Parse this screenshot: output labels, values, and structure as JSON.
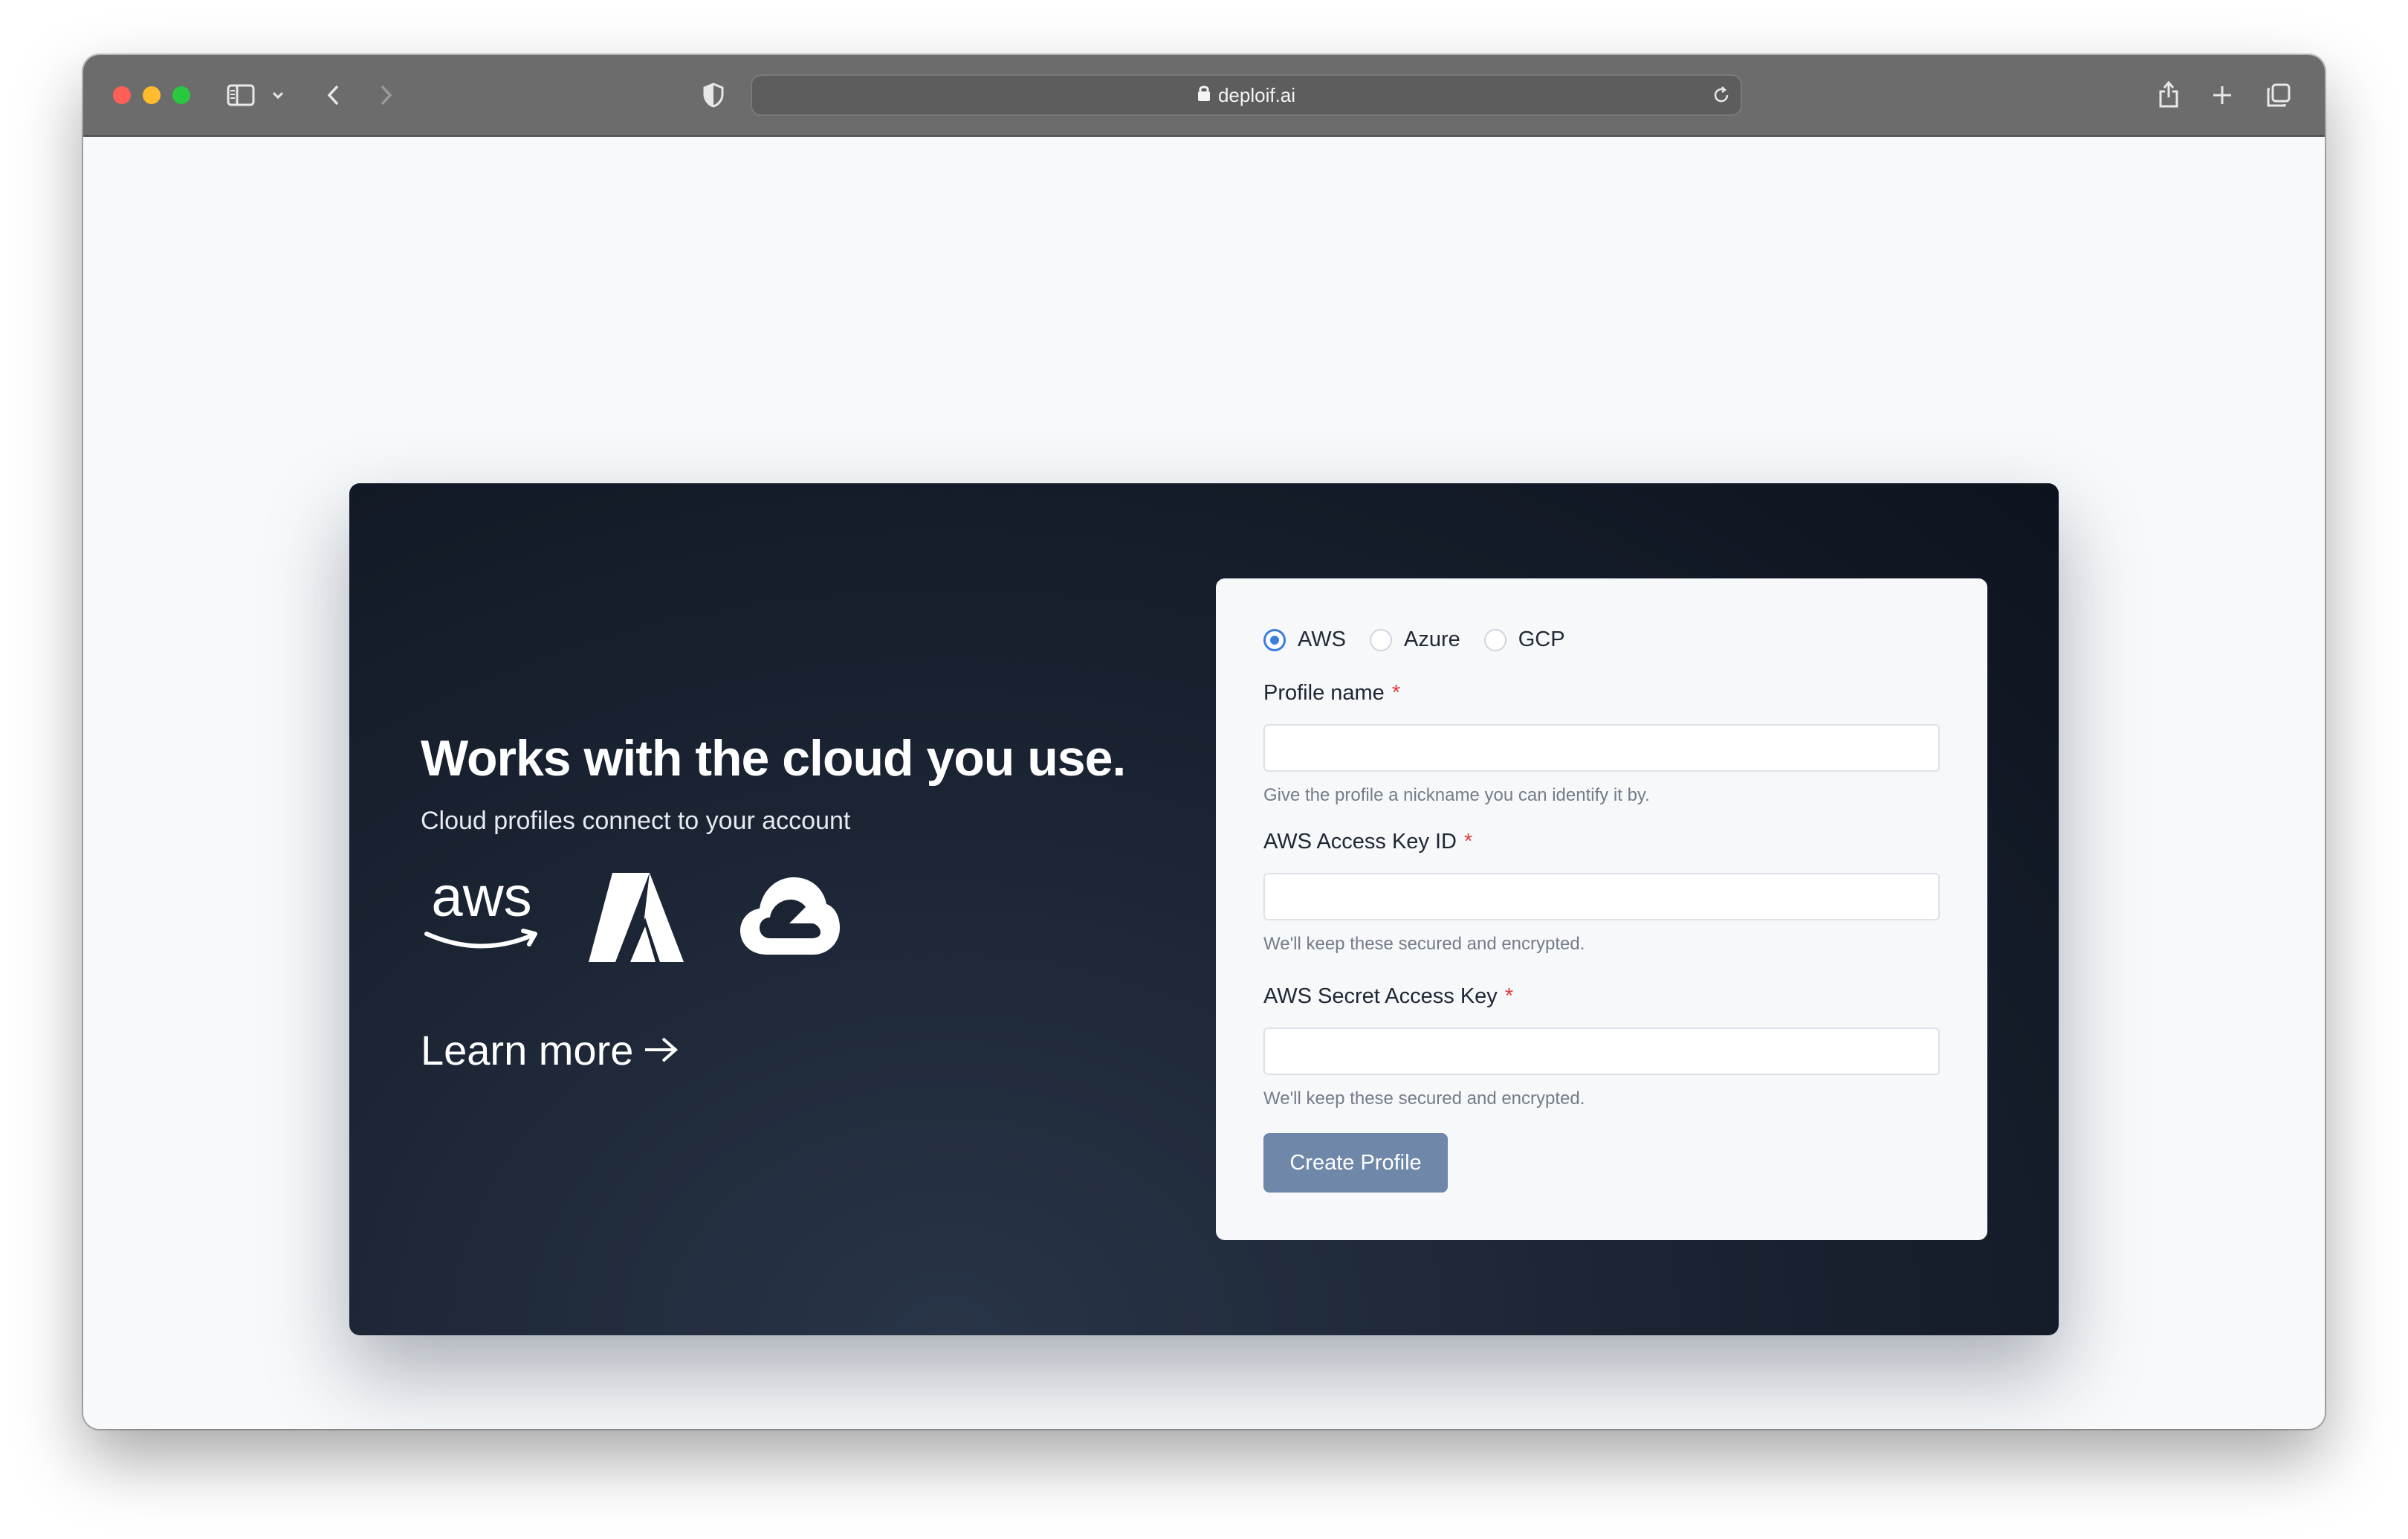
{
  "browser": {
    "url": "deploif.ai"
  },
  "hero": {
    "title": "Works with the cloud you use.",
    "subtitle": "Cloud profiles connect to your account",
    "learn_more": "Learn more",
    "logos": [
      {
        "name": "aws",
        "label": "aws"
      },
      {
        "name": "azure",
        "label": ""
      },
      {
        "name": "gcp",
        "label": ""
      }
    ]
  },
  "form": {
    "providers": [
      {
        "label": "AWS",
        "selected": true
      },
      {
        "label": "Azure",
        "selected": false
      },
      {
        "label": "GCP",
        "selected": false
      }
    ],
    "profile_name": {
      "label": "Profile name",
      "required_mark": "*",
      "value": "",
      "help": "Give the profile a nickname you can identify it by."
    },
    "access_key_id": {
      "label": "AWS Access Key ID",
      "required_mark": "*",
      "value": "",
      "help": "We'll keep these secured and encrypted."
    },
    "secret_access_key": {
      "label": "AWS Secret Access Key",
      "required_mark": "*",
      "value": "",
      "help": "We'll keep these secured and encrypted."
    },
    "submit_label": "Create Profile"
  },
  "colors": {
    "accent": "#3b7ddd",
    "button": "#6f87a8",
    "required": "#e03b3b",
    "hero_dark": "#0d131e"
  }
}
